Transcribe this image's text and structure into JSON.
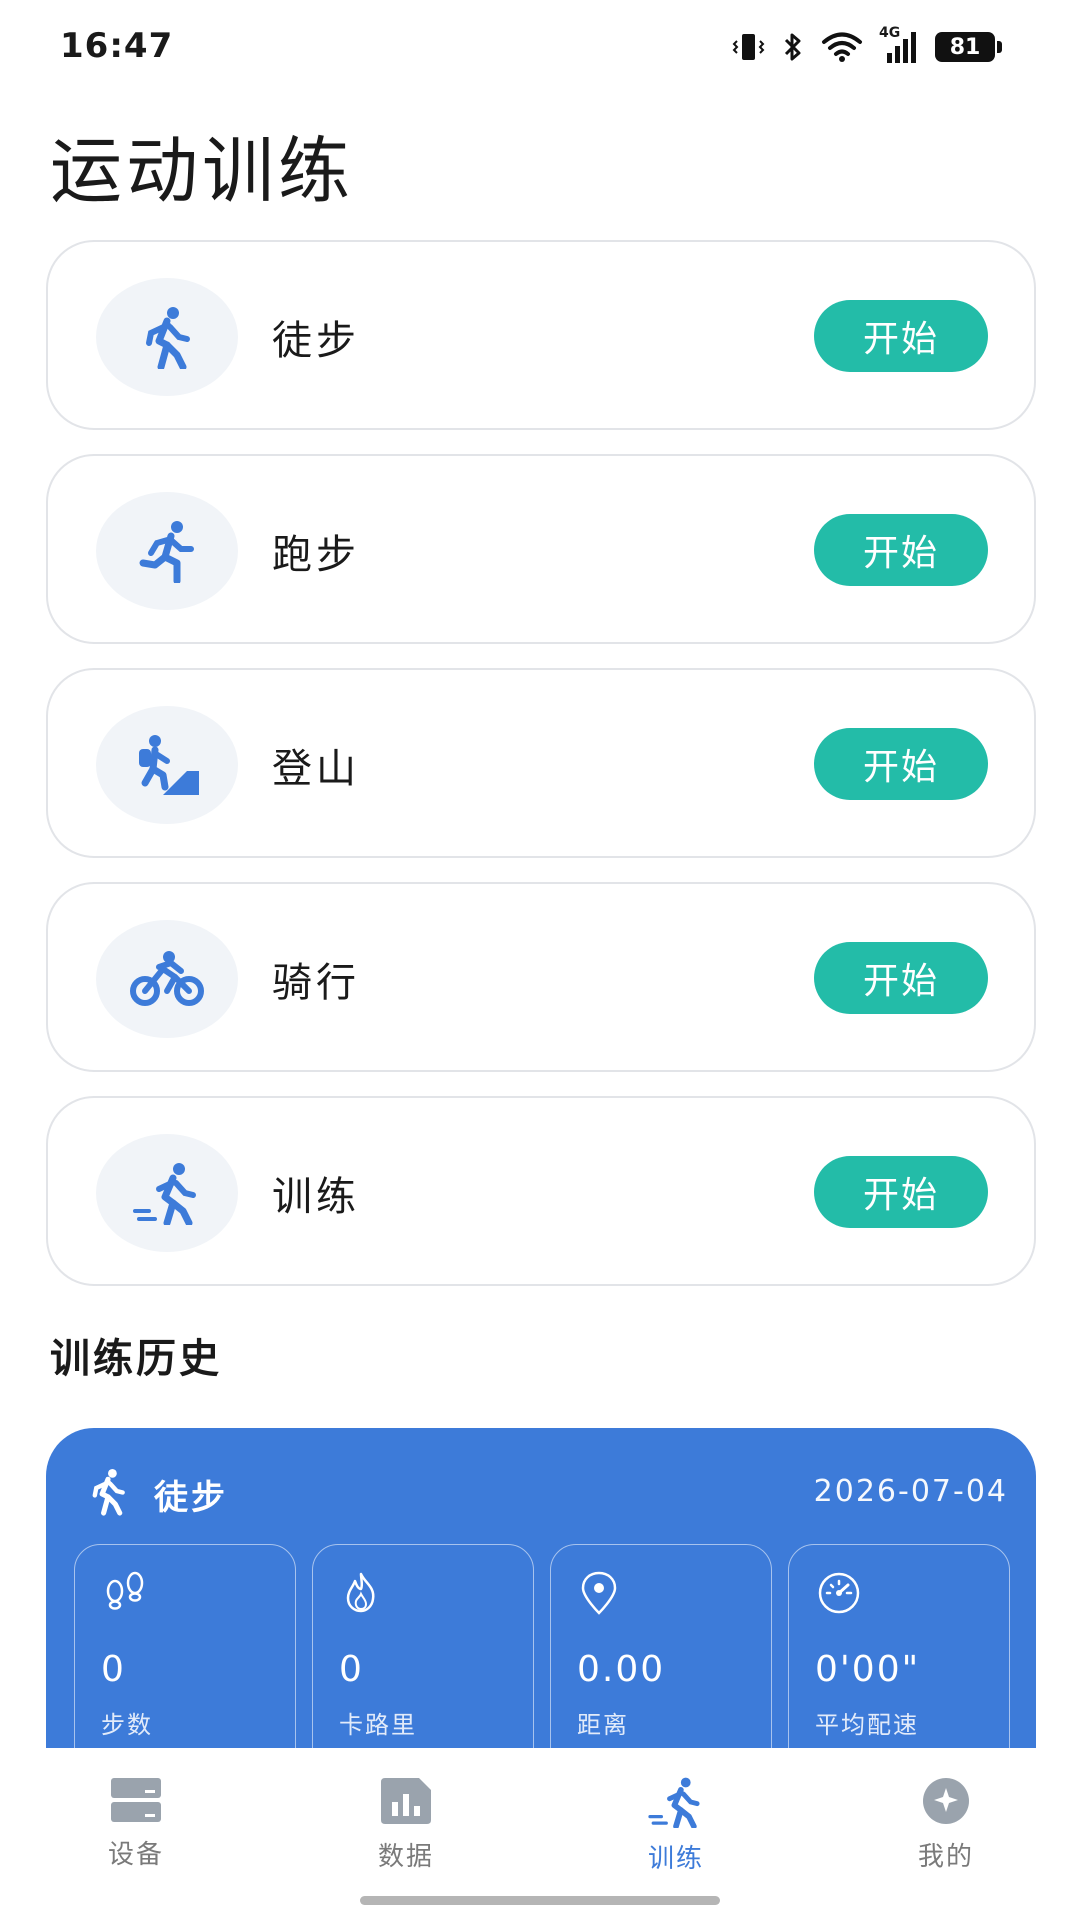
{
  "status_bar": {
    "time": "16:47",
    "battery": "81",
    "network": "4G",
    "icons": [
      "vibrate-icon",
      "bluetooth-icon",
      "wifi-icon",
      "signal-icon",
      "battery-icon"
    ]
  },
  "page": {
    "title": "运动训练"
  },
  "sports": [
    {
      "label": "徒步",
      "icon": "walking-icon",
      "button": "开始"
    },
    {
      "label": "跑步",
      "icon": "running-icon",
      "button": "开始"
    },
    {
      "label": "登山",
      "icon": "hiking-icon",
      "button": "开始"
    },
    {
      "label": "骑行",
      "icon": "cycling-icon",
      "button": "开始"
    },
    {
      "label": "训练",
      "icon": "training-icon",
      "button": "开始"
    }
  ],
  "history": {
    "title": "训练历史",
    "record": {
      "type": "徒步",
      "date": "2026-07-04",
      "stats": [
        {
          "icon": "footprints-icon",
          "value": "0",
          "label": "步数"
        },
        {
          "icon": "flame-icon",
          "value": "0",
          "label": "卡路里"
        },
        {
          "icon": "location-pin-icon",
          "value": "0.00",
          "label": "距离"
        },
        {
          "icon": "speedometer-icon",
          "value": "0'00\"",
          "label": "平均配速"
        }
      ]
    }
  },
  "nav": {
    "items": [
      {
        "label": "设备",
        "icon": "device-icon",
        "active": false
      },
      {
        "label": "数据",
        "icon": "data-chart-icon",
        "active": false
      },
      {
        "label": "训练",
        "icon": "training-icon",
        "active": true
      },
      {
        "label": "我的",
        "icon": "profile-icon",
        "active": false
      }
    ]
  },
  "colors": {
    "accent_button": "#23bca8",
    "primary_blue": "#3d7bd9",
    "icon_blue": "#3d7bd9",
    "nav_inactive": "#7a7a7a"
  }
}
